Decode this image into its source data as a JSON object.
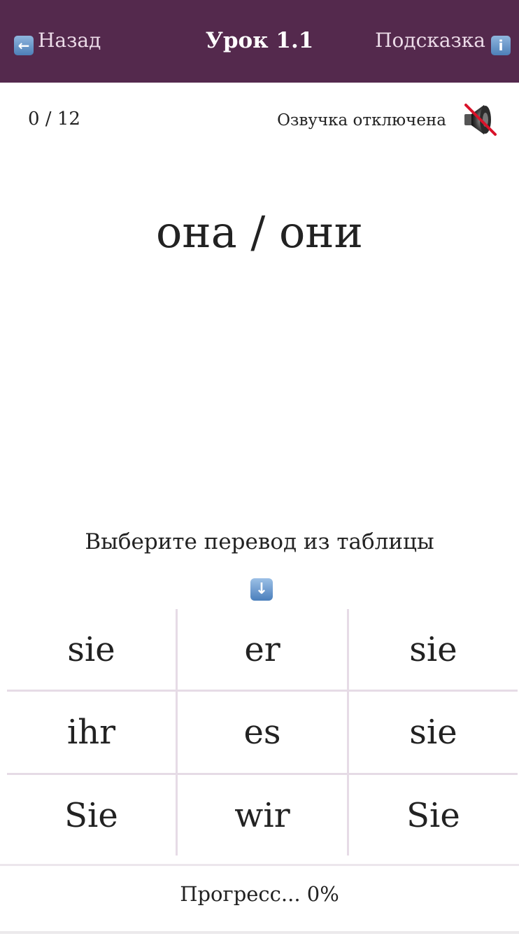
{
  "header": {
    "back_label": "Назад",
    "back_icon": "left-arrow-key-icon",
    "title": "Урок 1.1",
    "hint_label": "Подсказка",
    "hint_icon": "information-key-icon",
    "background_color": "#54294d"
  },
  "status": {
    "counter": "0 / 12",
    "sound_label": "Озвучка отключена",
    "sound_icon": "muted-speaker-icon"
  },
  "prompt": {
    "word": "она / они"
  },
  "task": {
    "instruction": "Выберите перевод из таблицы",
    "arrow_icon": "down-arrow-key-icon"
  },
  "answers": [
    [
      "sie",
      "er",
      "sie"
    ],
    [
      "ihr",
      "es",
      "sie"
    ],
    [
      "Sie",
      "wir",
      "Sie"
    ]
  ],
  "progress": {
    "label": "Прогресс... 0%",
    "value_percent": 0
  }
}
